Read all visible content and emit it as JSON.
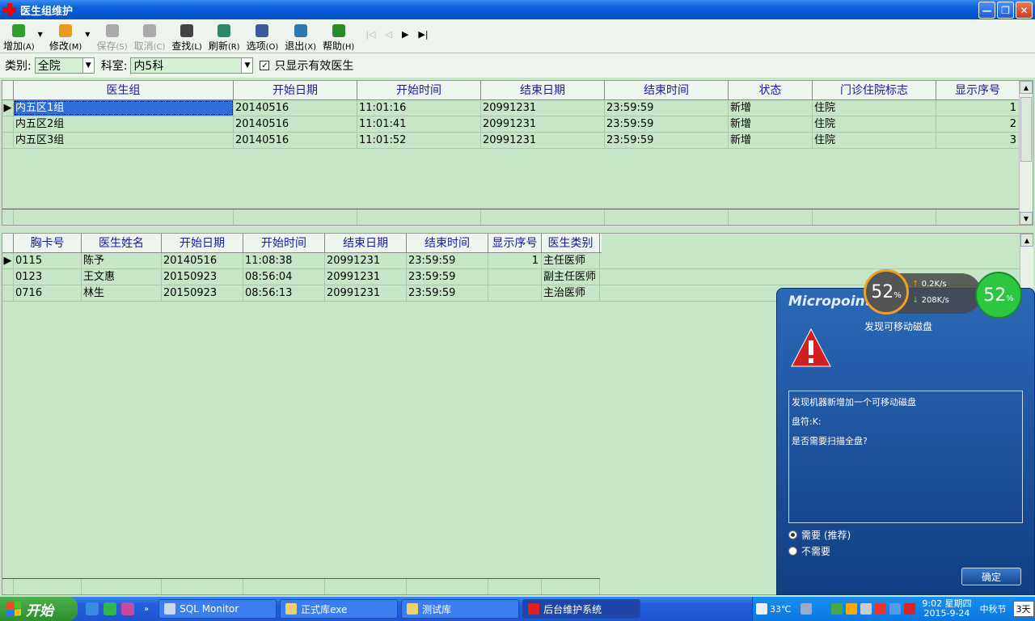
{
  "window": {
    "title": "医生组维护",
    "min": "—",
    "max": "❐",
    "close": "✕"
  },
  "toolbar": {
    "buttons": [
      {
        "label": "增加",
        "key": "(A)",
        "icon": "add-icon",
        "color": "#2e9e2e",
        "enabled": true
      },
      {
        "label": "修改",
        "key": "(M)",
        "icon": "edit-icon",
        "color": "#e89a20",
        "enabled": true
      },
      {
        "label": "保存",
        "key": "(S)",
        "icon": "save-icon",
        "color": "#aaaaaa",
        "enabled": false
      },
      {
        "label": "取消",
        "key": "(C)",
        "icon": "cancel-icon",
        "color": "#aaaaaa",
        "enabled": false
      },
      {
        "label": "查找",
        "key": "(L)",
        "icon": "search-icon",
        "color": "#444444",
        "enabled": true
      },
      {
        "label": "刷新",
        "key": "(R)",
        "icon": "refresh-icon",
        "color": "#2a8a6a",
        "enabled": true
      },
      {
        "label": "选项",
        "key": "(O)",
        "icon": "options-icon",
        "color": "#3a5a9a",
        "enabled": true
      },
      {
        "label": "退出",
        "key": "(X)",
        "icon": "exit-icon",
        "color": "#2a7ab0",
        "enabled": true
      },
      {
        "label": "帮助",
        "key": "(H)",
        "icon": "help-icon",
        "color": "#2a8a2a",
        "enabled": true
      }
    ],
    "nav": [
      "|◁",
      "◁",
      "▶",
      "▶|"
    ]
  },
  "filter": {
    "category_label": "类别:",
    "category_value": "全院",
    "dept_label": "科室:",
    "dept_value": "内5科",
    "checkbox_label": "只显示有效医生",
    "checkbox_mark": "✓"
  },
  "groups": {
    "headers": [
      "医生组",
      "开始日期",
      "开始时间",
      "结束日期",
      "结束时间",
      "状态",
      "门诊住院标志",
      "显示序号"
    ],
    "rows": [
      [
        "内五区1组",
        "20140516",
        "11:01:16",
        "20991231",
        "23:59:59",
        "新增",
        "住院",
        "1"
      ],
      [
        "内五区2组",
        "20140516",
        "11:01:41",
        "20991231",
        "23:59:59",
        "新增",
        "住院",
        "2"
      ],
      [
        "内五区3组",
        "20140516",
        "11:01:52",
        "20991231",
        "23:59:59",
        "新增",
        "住院",
        "3"
      ]
    ],
    "pointer": "▶"
  },
  "doctors": {
    "headers": [
      "胸卡号",
      "医生姓名",
      "开始日期",
      "开始时间",
      "结束日期",
      "结束时间",
      "显示序号",
      "医生类别"
    ],
    "rows": [
      [
        "0115",
        "陈予",
        "20140516",
        "11:08:38",
        "20991231",
        "23:59:59",
        "1",
        "主任医师"
      ],
      [
        "0123",
        "王文惠",
        "20150923",
        "08:56:04",
        "20991231",
        "23:59:59",
        "",
        "副主任医师"
      ],
      [
        "0716",
        "林生",
        "20150923",
        "08:56:13",
        "20991231",
        "23:59:59",
        "",
        "主治医师"
      ]
    ],
    "pointer": "▶"
  },
  "popup": {
    "brand": "Micropoint",
    "title": "发现可移动磁盘",
    "lines": [
      "发现机器新增加一个可移动磁盘",
      "盘符:K:",
      "是否需要扫描全盘?"
    ],
    "option_yes": "需要 (推荐)",
    "option_no": "不需要",
    "ok": "确定"
  },
  "monitor": {
    "cpu": "52",
    "cpu_unit": "%",
    "mem": "52",
    "mem_unit": "%",
    "up": "0.2",
    "up_unit": "K/s",
    "down": "208",
    "down_unit": "K/s"
  },
  "taskbar": {
    "start": "开始",
    "tasks": [
      {
        "label": "SQL Monitor",
        "icon": "sql-monitor-icon"
      },
      {
        "label": "正式库exe",
        "icon": "folder-icon"
      },
      {
        "label": "测试库",
        "icon": "folder-icon"
      },
      {
        "label": "后台维护系统",
        "icon": "app-cross-icon"
      }
    ],
    "weather": "33℃",
    "time": "9:02 星期四",
    "date": "2015-9-24",
    "holiday": "中秋节",
    "days": "3天"
  }
}
